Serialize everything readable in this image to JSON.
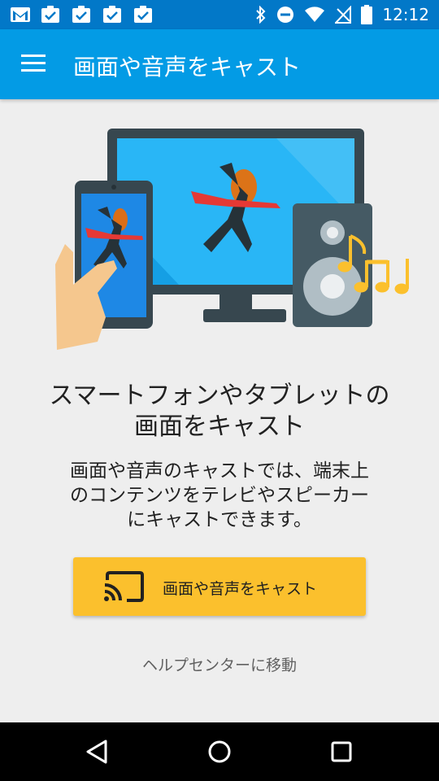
{
  "status_bar": {
    "time": "12:12",
    "icons_left": [
      "gmail-icon",
      "task-check-icon",
      "task-check-icon",
      "task-check-icon",
      "task-check-icon"
    ],
    "icons_right": [
      "bluetooth-icon",
      "do-not-disturb-icon",
      "wifi-icon",
      "no-signal-icon",
      "battery-icon"
    ]
  },
  "app_bar": {
    "title": "画面や音声をキャスト",
    "color": "#039be5"
  },
  "content": {
    "headline_line1": "スマートフォンやタブレットの",
    "headline_line2": "画面をキャスト",
    "body_line1": "画面や音声のキャストでは、端末上",
    "body_line2": "のコンテンツをテレビやスピーカー",
    "body_line3": "にキャストできます。",
    "cast_button_label": "画面や音声をキャスト",
    "cast_button_color": "#fbc02d",
    "help_link": "ヘルプセンターに移動"
  },
  "nav_bar": {
    "buttons": [
      "back-icon",
      "home-icon",
      "recents-icon"
    ]
  }
}
